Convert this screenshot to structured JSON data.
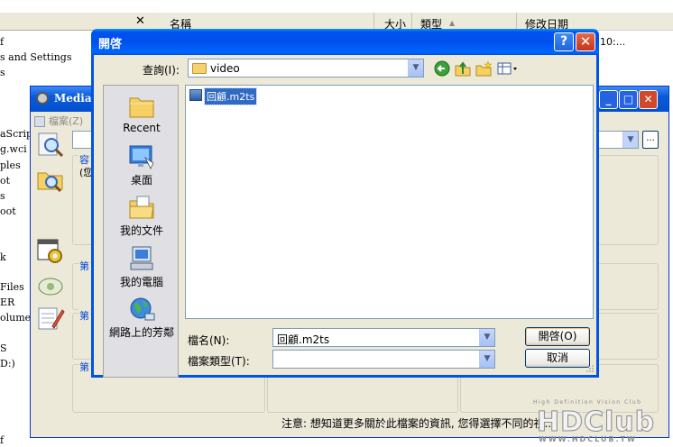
{
  "background_explorer": {
    "columns": {
      "name": "名稱",
      "size": "大小",
      "type": "類型",
      "modified": "修改日期"
    },
    "row_date_partial": "10:...",
    "tree_items": [
      "f",
      "s and Settings",
      "s",
      "aScripts",
      "g.wci",
      "ples",
      "ot",
      "s",
      "oot",
      "k",
      "Files",
      "ER",
      "olume I:",
      "S",
      "D:)",
      "f"
    ]
  },
  "mediainfo": {
    "title": "MediaI",
    "file_menu": "檔案(Z)",
    "group_partial_1": "容",
    "group_partial_2": "(您",
    "group_labels": [
      "第",
      "第",
      "第"
    ],
    "note": "注意: 想知道更多關於此檔案的資訊, 您得選擇不同的視...",
    "sidebar_icons": [
      "magnifier-page-icon",
      "folder-search-icon",
      "gear-window-icon",
      "settings-icon",
      "notepad-icon"
    ]
  },
  "open_dialog": {
    "title": "開啓",
    "help": "?",
    "close": "✕",
    "lookin_label": "查詢(I):",
    "lookin_value": "video",
    "places": [
      {
        "label": "Recent",
        "icon": "recent-folder-icon"
      },
      {
        "label": "桌面",
        "icon": "desktop-icon"
      },
      {
        "label": "我的文件",
        "icon": "my-documents-icon"
      },
      {
        "label": "我的電腦",
        "icon": "my-computer-icon"
      },
      {
        "label": "網路上的芳鄰",
        "icon": "network-places-icon"
      }
    ],
    "files": [
      {
        "name": "回顧.m2ts"
      }
    ],
    "filename_label": "檔名(N):",
    "filename_value": "回顧.m2ts",
    "filetype_label": "檔案類型(T):",
    "filetype_value": "",
    "open_button": "開啓(O)",
    "cancel_button": "取消"
  },
  "watermark": {
    "tagline": "High Definition Vision Club",
    "logo": "HDClub",
    "site": "WWW.HDCLUB.TW"
  }
}
